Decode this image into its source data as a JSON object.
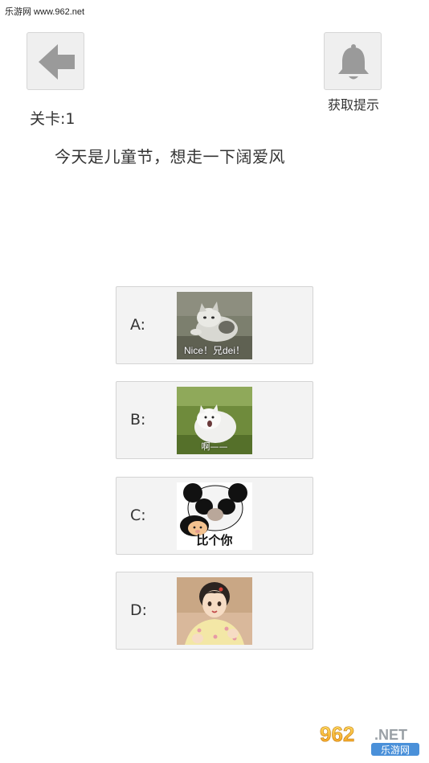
{
  "watermark_top": "乐游网 www.962.net",
  "toolbar": {
    "back_icon": "arrow-left-icon",
    "hint_icon": "bell-icon",
    "hint_label": "获取提示"
  },
  "level": {
    "label": "关卡:1"
  },
  "question": "今天是儿童节，想走一下阔爱风",
  "options": [
    {
      "letter": "A:",
      "image": "cat-meme",
      "caption": "Nice！兄dei！"
    },
    {
      "letter": "B:",
      "image": "white-cat-screaming-meme",
      "caption": "啊——"
    },
    {
      "letter": "C:",
      "image": "panda-face-meme",
      "caption": "比个你"
    },
    {
      "letter": "D:",
      "image": "anime-girl-portrait",
      "caption": ""
    }
  ],
  "watermark_logo": {
    "number": "962",
    "suffix": ".NET",
    "text": "乐游网"
  },
  "colors": {
    "button_bg": "#efefef",
    "icon_gray": "#9a9a9a",
    "option_bg": "#f3f3f3",
    "text": "#333333"
  }
}
